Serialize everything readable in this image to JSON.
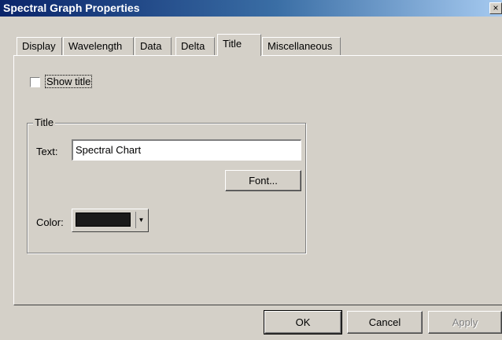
{
  "window": {
    "title": "Spectral Graph Properties",
    "close_symbol": "×"
  },
  "tabs": [
    {
      "label": "Display"
    },
    {
      "label": "Wavelength"
    },
    {
      "label": "Data"
    },
    {
      "label": "Delta"
    },
    {
      "label": "Title",
      "active": true
    },
    {
      "label": "Miscellaneous"
    }
  ],
  "show_title": {
    "label": "Show title",
    "checked": false
  },
  "title_group": {
    "legend": "Title",
    "text_label": "Text:",
    "text_value": "Spectral Chart",
    "font_button": "Font...",
    "color_label": "Color:",
    "color_value": "#1a1a1a"
  },
  "buttons": {
    "ok": "OK",
    "cancel": "Cancel",
    "apply": "Apply",
    "apply_enabled": false
  },
  "icons": {
    "close": "close-icon",
    "dropdown": "chevron-down-icon"
  }
}
